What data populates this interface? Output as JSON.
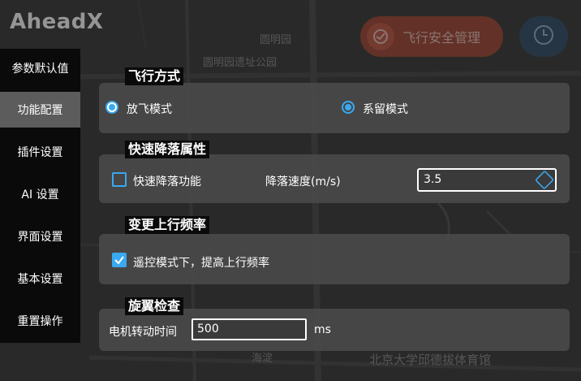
{
  "app": {
    "brand": "AheadX"
  },
  "topbar": {
    "safety_label": "飞行安全管理",
    "safety_icon": "safety-shield-icon",
    "clock_icon": "clock-icon"
  },
  "map": {
    "labels": [
      "圆明园",
      "圆明园遗址公园",
      "海淀",
      "北京大学邱德拔体育馆"
    ]
  },
  "sidebar": {
    "items": [
      {
        "label": "参数默认值"
      },
      {
        "label": "功能配置"
      },
      {
        "label": "插件设置"
      },
      {
        "label": "AI 设置"
      },
      {
        "label": "界面设置"
      },
      {
        "label": "基本设置"
      },
      {
        "label": "重置操作"
      }
    ],
    "active_index": 1
  },
  "flight_mode": {
    "title": "飞行方式",
    "options": [
      "放飞模式",
      "系留模式"
    ],
    "selected": "放飞模式"
  },
  "quick_landing": {
    "title": "快速降落属性",
    "checkbox_label": "快速降落功能",
    "checked": false,
    "speed_label": "降落速度(m/s)",
    "speed_value": "3.5"
  },
  "uplink": {
    "title": "变更上行频率",
    "checkbox_label": "遥控模式下，提高上行频率",
    "checked": true
  },
  "rotor_check": {
    "title": "旋翼检查",
    "motor_label": "电机转动时间",
    "motor_value": "500",
    "unit": "ms"
  },
  "colors": {
    "accent": "#39a9f0",
    "safety": "#a54a38",
    "panel": "#4b4b4b"
  }
}
